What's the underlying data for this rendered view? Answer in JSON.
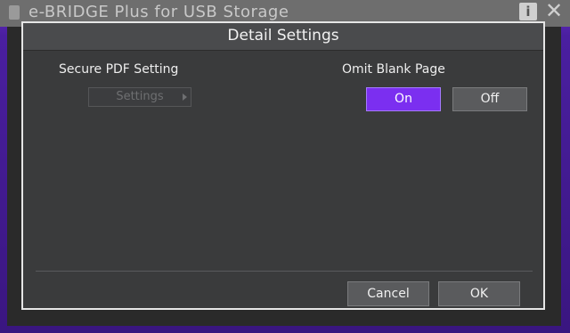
{
  "background_window": {
    "title": "e-BRIDGE Plus for USB Storage",
    "info_icon": "i",
    "close_icon": "✕"
  },
  "dialog": {
    "title": "Detail Settings",
    "secure_pdf": {
      "label": "Secure PDF Setting",
      "settings_button": "Settings",
      "settings_enabled": false
    },
    "omit_blank_page": {
      "label": "Omit Blank Page",
      "on_label": "On",
      "off_label": "Off",
      "selected": "On"
    },
    "footer": {
      "cancel_label": "Cancel",
      "ok_label": "OK"
    }
  },
  "colors": {
    "accent": "#7b2ff0",
    "dialog_bg": "#3a3b3c",
    "button_bg": "#5a5b5d",
    "frame": "#4a1fa0"
  }
}
